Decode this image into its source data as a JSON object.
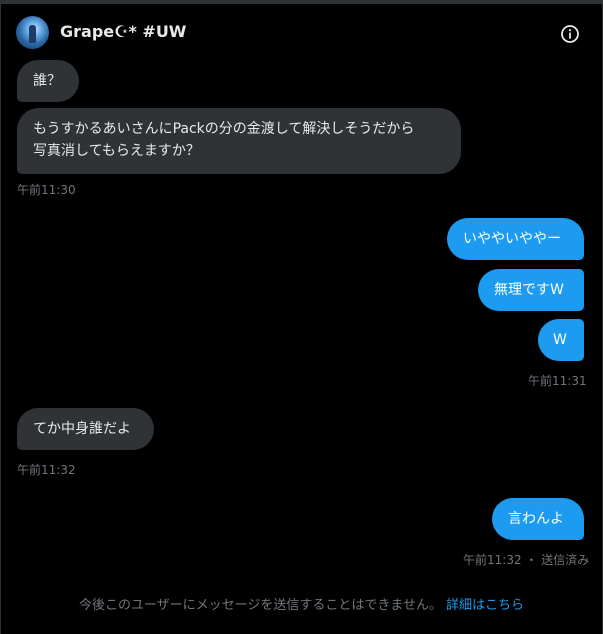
{
  "header": {
    "title": "Grape☪* #UW",
    "avatar_icon": "user-avatar",
    "info_icon": "info-icon"
  },
  "messages": [
    {
      "side": "in",
      "text": "誰？"
    },
    {
      "side": "in",
      "line1": "もうすかるあいさんにPackの分の金渡して解決しそうだから",
      "line2": "写真消してもらえますか？"
    },
    {
      "side": "out",
      "text": "いややいややー"
    },
    {
      "side": "out",
      "text": "無理ですW"
    },
    {
      "side": "out",
      "text": "W"
    },
    {
      "side": "in",
      "text": "てか中身誰だよ"
    },
    {
      "side": "out",
      "text": "言わんよ"
    }
  ],
  "timestamps": {
    "t1": "午前11:30",
    "t2": "午前11:31",
    "t3": "午前11:32",
    "t4": "午前11:32 ・ 送信済み"
  },
  "footer": {
    "notice": "今後このユーザーにメッセージを送信することはできません。",
    "link": "詳細はこちら"
  },
  "colors": {
    "incoming_bubble": "#2f3336",
    "outgoing_bubble": "#1d9bf0",
    "accent": "#1d9bf0"
  }
}
